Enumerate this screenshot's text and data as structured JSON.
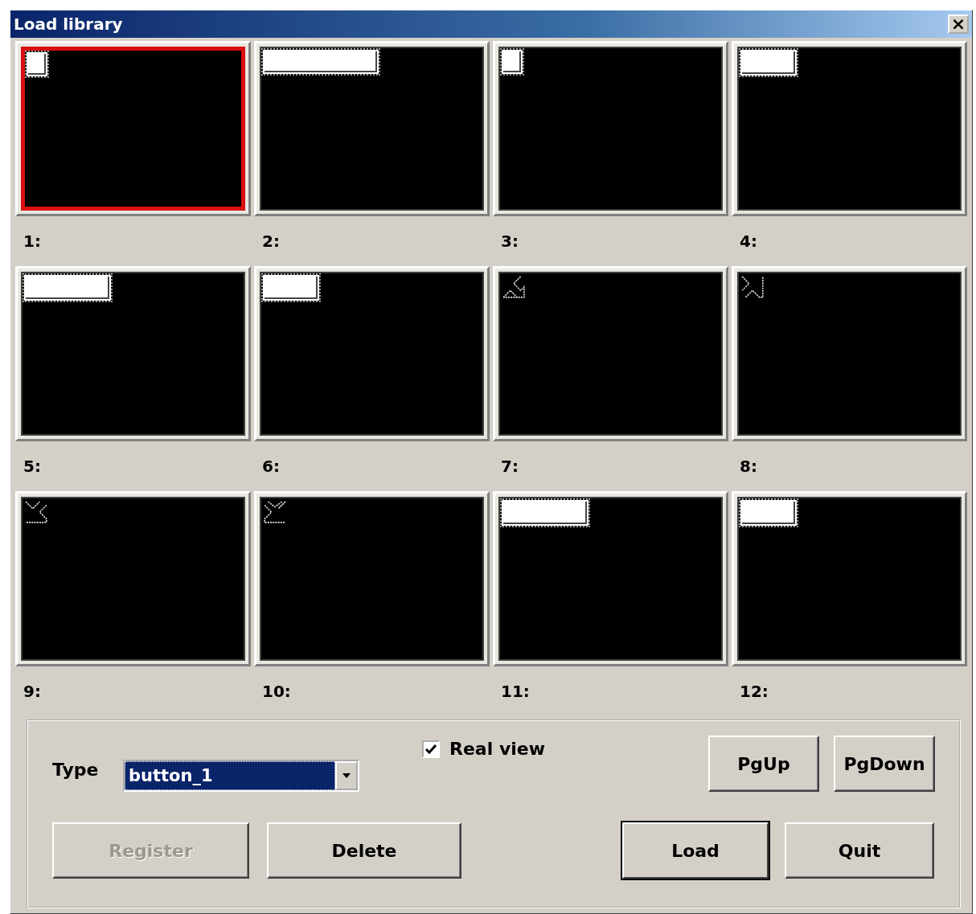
{
  "window": {
    "title": "Load library",
    "close": "×"
  },
  "slots": [
    {
      "label": "1:",
      "selected": true,
      "kind": "square"
    },
    {
      "label": "2:",
      "selected": false,
      "kind": "longbar"
    },
    {
      "label": "3:",
      "selected": false,
      "kind": "square"
    },
    {
      "label": "4:",
      "selected": false,
      "kind": "bar"
    },
    {
      "label": "5:",
      "selected": false,
      "kind": "widebar"
    },
    {
      "label": "6:",
      "selected": false,
      "kind": "bar"
    },
    {
      "label": "7:",
      "selected": false,
      "kind": "northeast"
    },
    {
      "label": "8:",
      "selected": false,
      "kind": "northwest"
    },
    {
      "label": "9:",
      "selected": false,
      "kind": "southwest"
    },
    {
      "label": "10:",
      "selected": false,
      "kind": "southeast"
    },
    {
      "label": "11:",
      "selected": false,
      "kind": "widebar"
    },
    {
      "label": "12:",
      "selected": false,
      "kind": "bar"
    }
  ],
  "type": {
    "label": "Type",
    "value": "button_1"
  },
  "real_view": {
    "label": "Real view",
    "checked": true
  },
  "buttons": [
    {
      "label": "PgUp",
      "disabled": false,
      "default": false
    },
    {
      "label": "PgDown",
      "disabled": false,
      "default": false
    },
    {
      "label": "Register",
      "disabled": true,
      "default": false
    },
    {
      "label": "Delete",
      "disabled": false,
      "default": false
    },
    {
      "label": "Load",
      "disabled": false,
      "default": true
    },
    {
      "label": "Quit",
      "disabled": false,
      "default": false
    }
  ]
}
